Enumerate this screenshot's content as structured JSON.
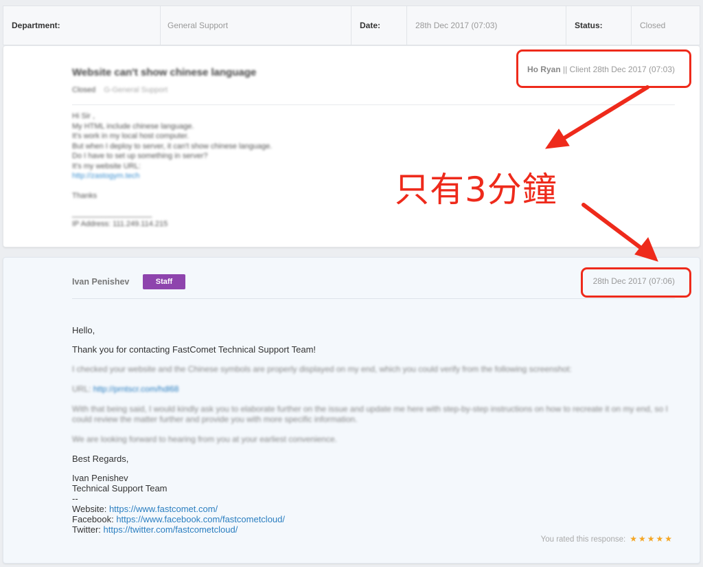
{
  "info": {
    "department_label": "Department:",
    "department_value": "General Support",
    "date_label": "Date:",
    "date_value": "28th Dec 2017 (07:03)",
    "status_label": "Status:",
    "status_value": "Closed"
  },
  "client": {
    "subject": "Website can't show chinese language",
    "status_tag": "Closed",
    "department_tag": "G-General Support",
    "author": "Ho Ryan",
    "meta_rest": " || Client 28th Dec 2017 (07:03)",
    "body_lines": [
      "Hi Sir ,",
      "My HTML include chinese language.",
      "It's work in my local host computer.",
      "But when I deploy to server, it can't show chinese language.",
      "Do I have to set up something in server?",
      "It's my website URL:"
    ],
    "body_link": "http://zastogym.tech",
    "thanks": "Thanks",
    "signature_line": "___________________",
    "ip_address": "IP Address: 111.249.114.215"
  },
  "staff": {
    "name": "Ivan Penishev",
    "badge": "Staff",
    "date": "28th Dec 2017 (07:06)",
    "greeting": "Hello,",
    "thanks_line": "Thank you for contacting FastComet Technical Support Team!",
    "blur_p1": "I checked your website and the Chinese symbols are properly displayed on my end, which you could verify from the following screenshot:",
    "url_label": "URL:",
    "url_value": "http://prntscr.com/hdl68",
    "blur_p3": "With that being said, I would kindly ask you to elaborate further on the issue and update me here with step-by-step instructions on how to recreate it on my end, so I could review the matter further and provide you with more specific information.",
    "blur_p4": "We are looking forward to hearing from you at your earliest convenience.",
    "regards": "Best Regards,",
    "sig_name": "Ivan Penishev",
    "sig_team": "Technical Support Team",
    "sig_sep": "--",
    "website_label": "Website: ",
    "website_url": "https://www.fastcomet.com/",
    "facebook_label": "Facebook: ",
    "facebook_url": "https://www.facebook.com/fastcometcloud/",
    "twitter_label": "Twitter: ",
    "twitter_url": "https://twitter.com/fastcometcloud/",
    "rating_label": "You rated this response:",
    "rating_stars": "★★★★★",
    "rating_value": 5
  },
  "annotation": {
    "text": "只有3分鐘",
    "color": "#ee2a1b"
  },
  "colors": {
    "staff_badge": "#8e44ad",
    "link": "#2a7ec0",
    "star": "#f5a623"
  }
}
